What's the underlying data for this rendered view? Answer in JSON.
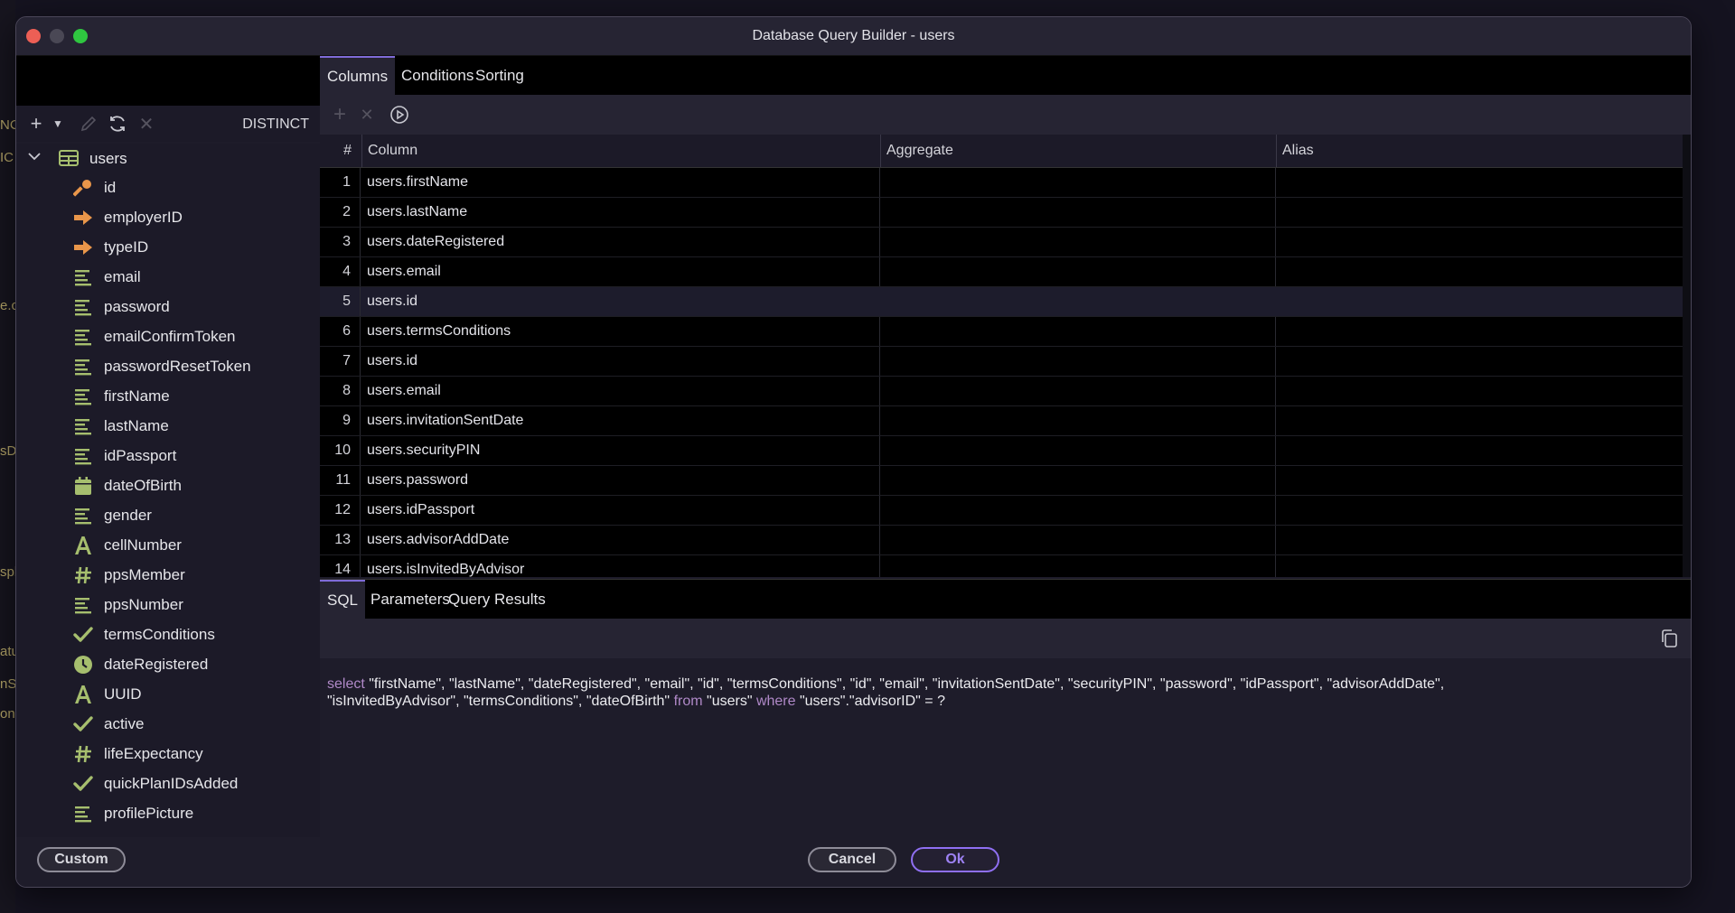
{
  "window": {
    "title": "Database Query Builder - users"
  },
  "bg_fragments": [
    "NC",
    "IC",
    "e.c",
    "sD",
    "spl",
    "atu",
    "nS",
    "on"
  ],
  "toolbar": {
    "distinct_label": "DISTINCT",
    "icons": [
      "plus-icon",
      "chevron-down-icon",
      "pencil-icon",
      "refresh-icon",
      "close-icon"
    ]
  },
  "tree": {
    "table": "users",
    "fields": [
      {
        "name": "id",
        "icon": "key-icon"
      },
      {
        "name": "employerID",
        "icon": "foreign-key-arrow-icon"
      },
      {
        "name": "typeID",
        "icon": "foreign-key-arrow-icon"
      },
      {
        "name": "email",
        "icon": "text-lines-icon"
      },
      {
        "name": "password",
        "icon": "text-lines-icon"
      },
      {
        "name": "emailConfirmToken",
        "icon": "text-lines-icon"
      },
      {
        "name": "passwordResetToken",
        "icon": "text-lines-icon"
      },
      {
        "name": "firstName",
        "icon": "text-lines-icon"
      },
      {
        "name": "lastName",
        "icon": "text-lines-icon"
      },
      {
        "name": "idPassport",
        "icon": "text-lines-icon"
      },
      {
        "name": "dateOfBirth",
        "icon": "calendar-icon"
      },
      {
        "name": "gender",
        "icon": "text-lines-icon"
      },
      {
        "name": "cellNumber",
        "icon": "letter-a-icon"
      },
      {
        "name": "ppsMember",
        "icon": "hash-icon"
      },
      {
        "name": "ppsNumber",
        "icon": "text-lines-icon"
      },
      {
        "name": "termsConditions",
        "icon": "checkmark-icon"
      },
      {
        "name": "dateRegistered",
        "icon": "clock-icon"
      },
      {
        "name": "UUID",
        "icon": "letter-a-icon"
      },
      {
        "name": "active",
        "icon": "checkmark-icon"
      },
      {
        "name": "lifeExpectancy",
        "icon": "hash-icon"
      },
      {
        "name": "quickPlanIDsAdded",
        "icon": "checkmark-icon"
      },
      {
        "name": "profilePicture",
        "icon": "text-lines-icon"
      }
    ]
  },
  "tabs": {
    "columns": "Columns",
    "conditions": "Conditions",
    "sorting": "Sorting"
  },
  "grid": {
    "headers": {
      "num": "#",
      "column": "Column",
      "aggregate": "Aggregate",
      "alias": "Alias"
    },
    "rows": [
      {
        "n": "1",
        "column": "users.firstName",
        "aggregate": "",
        "alias": ""
      },
      {
        "n": "2",
        "column": "users.lastName",
        "aggregate": "",
        "alias": ""
      },
      {
        "n": "3",
        "column": "users.dateRegistered",
        "aggregate": "",
        "alias": ""
      },
      {
        "n": "4",
        "column": "users.email",
        "aggregate": "",
        "alias": ""
      },
      {
        "n": "5",
        "column": "users.id",
        "aggregate": "",
        "alias": ""
      },
      {
        "n": "6",
        "column": "users.termsConditions",
        "aggregate": "",
        "alias": ""
      },
      {
        "n": "7",
        "column": "users.id",
        "aggregate": "",
        "alias": ""
      },
      {
        "n": "8",
        "column": "users.email",
        "aggregate": "",
        "alias": ""
      },
      {
        "n": "9",
        "column": "users.invitationSentDate",
        "aggregate": "",
        "alias": ""
      },
      {
        "n": "10",
        "column": "users.securityPIN",
        "aggregate": "",
        "alias": ""
      },
      {
        "n": "11",
        "column": "users.password",
        "aggregate": "",
        "alias": ""
      },
      {
        "n": "12",
        "column": "users.idPassport",
        "aggregate": "",
        "alias": ""
      },
      {
        "n": "13",
        "column": "users.advisorAddDate",
        "aggregate": "",
        "alias": ""
      },
      {
        "n": "14",
        "column": "users.isInvitedByAdvisor",
        "aggregate": "",
        "alias": ""
      }
    ],
    "selected_row": "5"
  },
  "bottom_tabs": {
    "sql": "SQL",
    "parameters": "Parameters",
    "query_results": "Query Results"
  },
  "sql": {
    "kw_select": "select",
    "cols": " \"firstName\", \"lastName\", \"dateRegistered\", \"email\", \"id\", \"termsConditions\", \"id\", \"email\", \"invitationSentDate\", \"securityPIN\", \"password\", \"idPassport\", \"advisorAddDate\",\n\"isInvitedByAdvisor\", \"termsConditions\", \"dateOfBirth\" ",
    "kw_from": "from",
    "table": " \"users\" ",
    "kw_where": "where",
    "cond": " \"users\".\"advisorID\" = ?"
  },
  "footer": {
    "custom": "Custom",
    "cancel": "Cancel",
    "ok": "Ok"
  },
  "colors": {
    "accent": "#8f6ff2",
    "icon_orange": "#e9964a",
    "icon_green": "#a6be6e",
    "keyword": "#b089c8"
  }
}
